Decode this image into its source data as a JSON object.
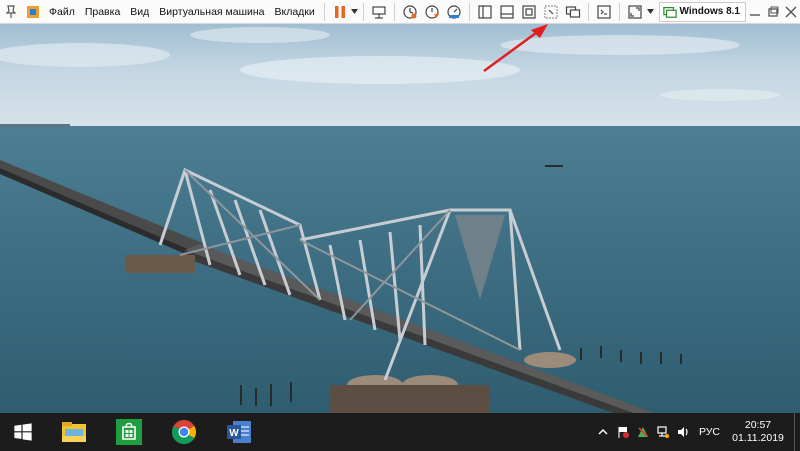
{
  "menu": {
    "file": "Файл",
    "edit": "Правка",
    "view": "Вид",
    "virtual_machine": "Виртуальная машина",
    "tabs": "Вкладки"
  },
  "vm_tab": {
    "label": "Windows 8.1",
    "icon": "vm-tab-icon"
  },
  "toolbar_icons": [
    "pin-icon",
    "home-icon",
    "pause-icon",
    "send-keys-icon",
    "snapshot-take-icon",
    "snapshot-revert-icon",
    "snapshot-manager-icon",
    "view-split-icon",
    "view-tabs-icon",
    "fit-window-icon",
    "stretch-icon",
    "unity-icon",
    "console-icon",
    "fullscreen-icon",
    "minimize-icon",
    "maximize-icon",
    "close-icon"
  ],
  "taskbar": {
    "apps": [
      "start-icon",
      "file-explorer-icon",
      "store-icon",
      "chrome-icon",
      "word-icon"
    ],
    "tray_icons": [
      "chevron-up-icon",
      "flag-icon",
      "security-icon",
      "network-icon",
      "volume-icon"
    ],
    "language": "РУС",
    "time": "20:57",
    "date": "01.11.2019"
  },
  "colors": {
    "toolbar_bg": "#fbfbfb",
    "taskbar_bg": "#1c1c1c",
    "pause_orange": "#e8661f",
    "annotation_arrow": "#e02020",
    "sky": "#b7cfe0",
    "sea": "#3e6f82"
  },
  "wallpaper": "bridge-over-sea"
}
